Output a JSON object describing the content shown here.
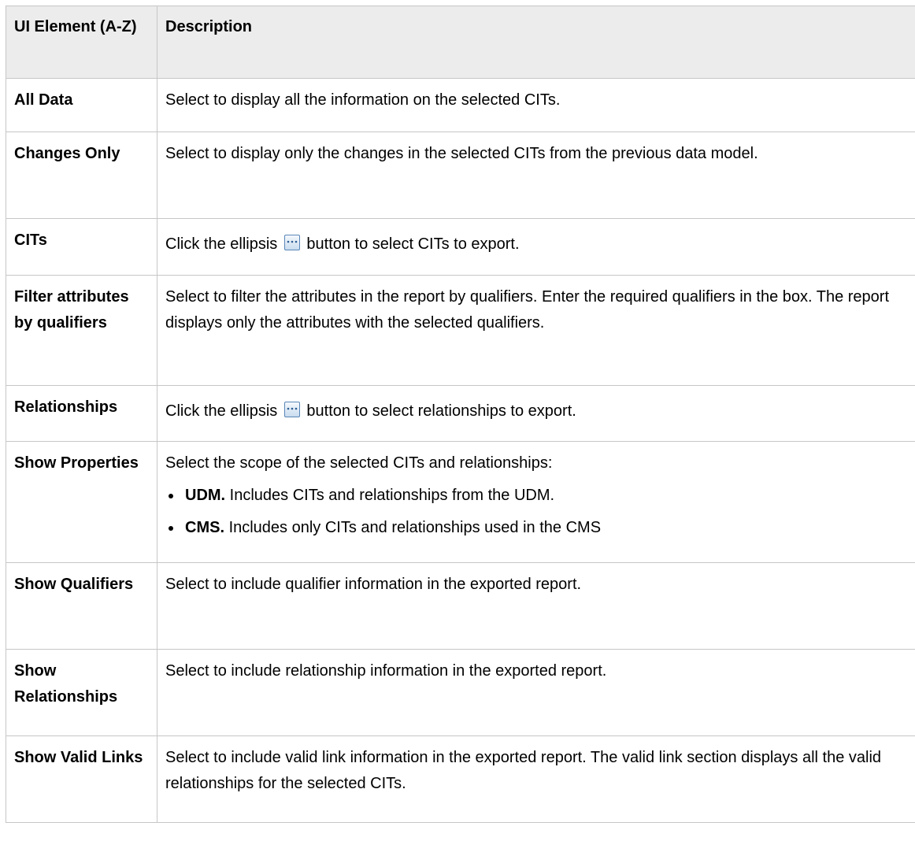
{
  "table": {
    "headers": {
      "element": "UI Element (A-Z)",
      "description": "Description"
    },
    "rows": [
      {
        "element": "All Data",
        "description": "Select to display all the information on the selected CITs."
      },
      {
        "element": "Changes Only",
        "description": "Select to display only the changes in the selected CITs from the previous data model."
      },
      {
        "element": "CITs",
        "desc_before": "Click the ellipsis",
        "desc_after": "button to select CITs to export."
      },
      {
        "element": "Filter attributes by qualifiers",
        "description": "Select to filter the attributes in the report by qualifiers. Enter the required qualifiers in the box. The report displays only the attributes with the selected qualifiers."
      },
      {
        "element": "Relationships",
        "desc_before": "Click the ellipsis",
        "desc_after": "button to select relationships to export."
      },
      {
        "element": "Show Properties",
        "description": "Select the scope of the selected CITs and relationships:",
        "bullets": [
          {
            "term": "UDM.",
            "text": "Includes CITs and relationships from the UDM."
          },
          {
            "term": "CMS.",
            "text": "Includes only CITs and relationships used in the CMS"
          }
        ]
      },
      {
        "element": "Show Qualifiers",
        "description": "Select to include qualifier information in the exported report."
      },
      {
        "element": "Show Relationships",
        "description": "Select to include relationship information in the exported report."
      },
      {
        "element": "Show Valid Links",
        "description": "Select to include valid link information in the exported report. The valid link section displays all the valid relationships for the selected CITs."
      }
    ]
  },
  "icons": {
    "ellipsis_button": "ellipsis-button-icon"
  },
  "colors": {
    "header_background": "#ececec",
    "border": "#c6c6c6",
    "icon_border": "#5a86b8"
  }
}
